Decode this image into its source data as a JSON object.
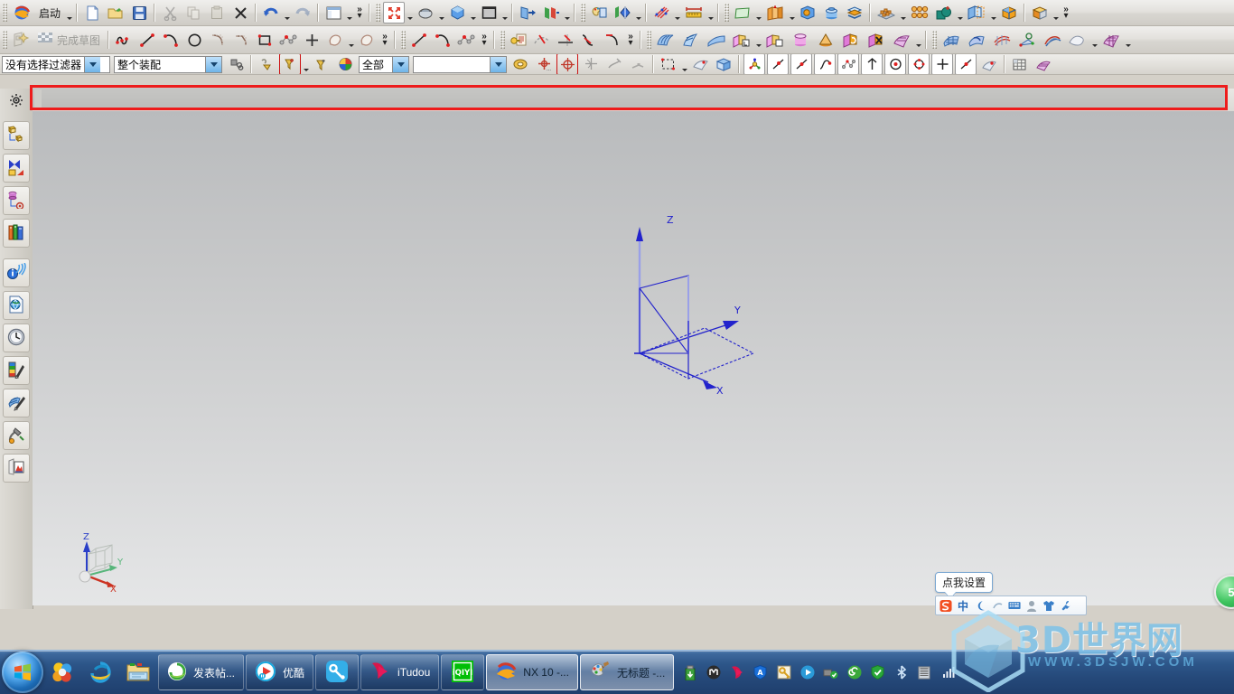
{
  "app": {
    "name": "NX 10",
    "colors": {
      "highlight_red": "#ee1c1c",
      "taskbar_blue": "#2d5689",
      "sketch_blue": "#2222dd",
      "watermark_blue": "#7ec2e8"
    }
  },
  "toolbar_row1": {
    "start_label": "启动",
    "items": [
      {
        "name": "nx-logo-icon",
        "icon": "nx-globe"
      },
      {
        "name": "start-menu-button",
        "icon": "text",
        "label": "启动",
        "caret": true
      },
      {
        "name": "new-file-button",
        "icon": "new-doc"
      },
      {
        "name": "open-file-button",
        "icon": "open-folder"
      },
      {
        "name": "save-button",
        "icon": "floppy"
      },
      {
        "name": "cut-button",
        "icon": "scissors",
        "disabled": true
      },
      {
        "name": "copy-button",
        "icon": "copy",
        "disabled": true
      },
      {
        "name": "paste-button",
        "icon": "paste",
        "disabled": true
      },
      {
        "name": "delete-button",
        "icon": "x-mark"
      },
      {
        "name": "undo-button",
        "icon": "undo",
        "caret": true
      },
      {
        "name": "redo-button",
        "icon": "redo",
        "disabled": true
      },
      {
        "name": "window-layout-button",
        "icon": "window",
        "caret": true
      },
      {
        "name": "fit-view-button",
        "icon": "fit-arrows",
        "caret": true
      },
      {
        "name": "zoom-button",
        "icon": "zoom-mouse",
        "caret": true
      },
      {
        "name": "rotate-button",
        "icon": "blue-cube",
        "caret": true
      },
      {
        "name": "shading-style-button",
        "icon": "gray-square",
        "caret": true
      },
      {
        "name": "show-hide-button",
        "icon": "blue-plane-arrow"
      },
      {
        "name": "hide-button",
        "icon": "green-red-plane",
        "caret": true
      },
      {
        "name": "edit-object-display-button",
        "icon": "palette-window"
      },
      {
        "name": "view-section-button",
        "icon": "section-flag",
        "caret": true
      },
      {
        "name": "measure-distance-button",
        "icon": "measure-pins",
        "caret": true
      },
      {
        "name": "measure-ruler-button",
        "icon": "ruler"
      },
      {
        "name": "datum-plane-button",
        "icon": "green-plane",
        "caret": true
      },
      {
        "name": "extrude-button",
        "icon": "orange-extrude",
        "caret": true
      },
      {
        "name": "hole-button",
        "icon": "blue-hole-cube"
      },
      {
        "name": "boss-button",
        "icon": "blue-cylinder"
      },
      {
        "name": "shell-button",
        "icon": "orange-shell"
      },
      {
        "name": "pattern-feature-button",
        "icon": "pattern-tray",
        "caret": true
      },
      {
        "name": "pattern-geometry-button",
        "icon": "pattern-grid"
      },
      {
        "name": "unite-button",
        "icon": "unite-green",
        "caret": true
      },
      {
        "name": "trim-body-button",
        "icon": "trim-cube",
        "caret": true
      },
      {
        "name": "edge-blend-button",
        "icon": "blend-cube"
      },
      {
        "name": "chamfer-button",
        "icon": "chamfer-cube",
        "caret": true
      }
    ]
  },
  "toolbar_row2": {
    "finish_sketch_label": "完成草图",
    "items": [
      {
        "name": "sketch-in-task-environment-button",
        "icon": "sketch-star",
        "disabled": true
      },
      {
        "name": "finish-sketch-button",
        "icon": "checkered-flag",
        "label": "完成草图",
        "disabled": true
      },
      {
        "name": "profile-button",
        "icon": "profile-curve"
      },
      {
        "name": "line-button",
        "icon": "line"
      },
      {
        "name": "arc-button",
        "icon": "arc"
      },
      {
        "name": "circle-button",
        "icon": "circle"
      },
      {
        "name": "fillet-button",
        "icon": "fillet"
      },
      {
        "name": "chamfer-sketch-button",
        "icon": "chamfer"
      },
      {
        "name": "rectangle-button",
        "icon": "rectangle"
      },
      {
        "name": "polygon-button",
        "icon": "studio-spline"
      },
      {
        "name": "point-button",
        "icon": "plus-point"
      },
      {
        "name": "offset-curve-button",
        "icon": "offset-blob",
        "caret": true
      },
      {
        "name": "pattern-curve-button",
        "icon": "pattern-blob"
      },
      {
        "name": "studio-spline-button",
        "icon": "spline-2pt"
      },
      {
        "name": "arc-3pt-button",
        "icon": "arc-3pt"
      },
      {
        "name": "fit-curve-button",
        "icon": "fit-curve"
      },
      {
        "name": "sketch-constraints-button",
        "icon": "key-doc"
      },
      {
        "name": "quick-trim-button",
        "icon": "quick-trim"
      },
      {
        "name": "quick-extend-button",
        "icon": "quick-extend"
      },
      {
        "name": "make-corner-button",
        "icon": "make-corner"
      },
      {
        "name": "corner-button",
        "icon": "corner"
      },
      {
        "name": "through-curve-mesh-button",
        "icon": "surface-mesh"
      },
      {
        "name": "ruled-button",
        "icon": "ruled-surface"
      },
      {
        "name": "swept-button",
        "icon": "swept-surface"
      },
      {
        "name": "extrude-sheet-button",
        "icon": "extrude-sheet",
        "caret": true
      },
      {
        "name": "revolve-sheet-button",
        "icon": "revolve-sheet",
        "caret": true
      },
      {
        "name": "tube-button",
        "icon": "tube"
      },
      {
        "name": "cone-button",
        "icon": "cone"
      },
      {
        "name": "replace-face-button",
        "icon": "replace-face"
      },
      {
        "name": "delete-face-button",
        "icon": "delete-face"
      },
      {
        "name": "trim-sheet-button",
        "icon": "trim-sheet",
        "caret": true
      },
      {
        "name": "four-point-surface-button",
        "icon": "four-point-surface"
      },
      {
        "name": "studio-surface-button",
        "icon": "studio-surface"
      },
      {
        "name": "n-sided-surface-button",
        "icon": "n-sided-surface"
      },
      {
        "name": "offset-surface-button",
        "icon": "offset-surface"
      },
      {
        "name": "bridge-surface-button",
        "icon": "bridge-surface"
      },
      {
        "name": "untrim-button",
        "icon": "untrim",
        "caret": true
      },
      {
        "name": "sheet-extend-button",
        "icon": "sheet-extend",
        "caret": true
      }
    ]
  },
  "toolbar_row3": {
    "selection_filter": {
      "name": "selection-filter-combo",
      "value": "没有选择过滤器"
    },
    "scope_filter": {
      "name": "assembly-scope-combo",
      "value": "整个装配"
    },
    "type_filter": {
      "name": "type-filter-combo",
      "value": "全部"
    },
    "layer_filter": {
      "name": "layer-filter-combo",
      "value": ""
    },
    "items": [
      {
        "name": "keep-selected-button",
        "icon": "keep-selected"
      },
      {
        "name": "general-selection-filter-button",
        "icon": "filter-plus",
        "highlight": true,
        "caret": true
      },
      {
        "name": "feature-filter-button",
        "icon": "filter-yellow"
      },
      {
        "name": "color-filter-button",
        "icon": "color-wheel"
      },
      {
        "name": "snap-point-settings-button",
        "icon": "snap-settings"
      },
      {
        "name": "enable-snap-button",
        "icon": "snap-target"
      },
      {
        "name": "snap-arc-center-button",
        "icon": "snap-center",
        "highlight": true
      },
      {
        "name": "snap-quadrant-button",
        "icon": "snap-quadrant"
      },
      {
        "name": "snap-existing-point-button",
        "icon": "snap-existing"
      },
      {
        "name": "snap-endpoint-button",
        "icon": "snap-endpoint",
        "disabled": true
      },
      {
        "name": "snap-control-point-button",
        "icon": "snap-control",
        "disabled": true
      },
      {
        "name": "rectangle-select-button",
        "icon": "rect-select",
        "caret": true
      },
      {
        "name": "select-faces-button",
        "icon": "face-select"
      },
      {
        "name": "select-body-button",
        "icon": "body-select"
      },
      {
        "name": "datum-csys-button",
        "icon": "datum-csys",
        "framed": true
      },
      {
        "name": "point-constructor-button",
        "icon": "point-line",
        "framed": true
      },
      {
        "name": "line-snap-button",
        "icon": "line-plain",
        "framed": true
      },
      {
        "name": "curve-snap-button",
        "icon": "curve-snap",
        "framed": true
      },
      {
        "name": "spline-snap-button",
        "icon": "spline-snap",
        "framed": true
      },
      {
        "name": "axis-snap-button",
        "icon": "axis-snap",
        "framed": true
      },
      {
        "name": "circle-center-snap-button",
        "icon": "circle-center",
        "framed": true
      },
      {
        "name": "quadrant-snap-button",
        "icon": "quadrant-snap",
        "framed": true
      },
      {
        "name": "point-snap-button",
        "icon": "plus-snap",
        "framed": true
      },
      {
        "name": "midpoint-snap-button",
        "icon": "mid-snap",
        "framed": true
      },
      {
        "name": "surface-snap-button",
        "icon": "surface-snap"
      },
      {
        "name": "grid-button",
        "icon": "grid-table"
      },
      {
        "name": "sketch-plane-button",
        "icon": "sketch-plane"
      }
    ]
  },
  "left_resource_bar": {
    "items": [
      {
        "name": "sidebar-item-settings",
        "icon": "gear-icon"
      },
      {
        "name": "sidebar-item-assembly-navigator",
        "icon": "assembly-tree-icon"
      },
      {
        "name": "sidebar-item-constraint-navigator",
        "icon": "constraint-icon"
      },
      {
        "name": "sidebar-item-part-navigator",
        "icon": "part-tree-icon"
      },
      {
        "name": "sidebar-item-reuse-library",
        "icon": "books-icon"
      },
      {
        "name": "sidebar-item-hd3d-tools",
        "icon": "info-signal-icon"
      },
      {
        "name": "sidebar-item-web-browser",
        "icon": "web-page-icon"
      },
      {
        "name": "sidebar-item-history",
        "icon": "clock-icon"
      },
      {
        "name": "sidebar-item-system-materials",
        "icon": "materials-icon"
      },
      {
        "name": "sidebar-item-system-scenes",
        "icon": "scenes-icon"
      },
      {
        "name": "sidebar-item-system-visual-effects",
        "icon": "effects-icon"
      },
      {
        "name": "sidebar-item-roles",
        "icon": "roles-icon"
      }
    ]
  },
  "viewport": {
    "csys_labels": {
      "x": "X",
      "y": "Y",
      "z": "Z"
    },
    "triad_labels": {
      "x": "X",
      "y": "Y",
      "z": "Z"
    }
  },
  "ime": {
    "tooltip": "点我设置",
    "items": [
      {
        "name": "sogou-logo-icon",
        "glyph": "S"
      },
      {
        "name": "chinese-mode-icon",
        "glyph": "中"
      },
      {
        "name": "moon-icon",
        "glyph": "☽"
      },
      {
        "name": "punctuation-icon",
        "glyph": "⌐"
      },
      {
        "name": "soft-keyboard-icon",
        "glyph": "⌨"
      },
      {
        "name": "user-icon",
        "glyph": "👤"
      },
      {
        "name": "skin-icon",
        "glyph": "👕"
      },
      {
        "name": "toolbox-icon",
        "glyph": "🔧"
      }
    ]
  },
  "taskbar": {
    "start_button": {
      "name": "start-button"
    },
    "quick_launch": [
      {
        "name": "quicklaunch-360-browser",
        "icon": "flower-360"
      },
      {
        "name": "quicklaunch-internet-explorer",
        "icon": "ie"
      },
      {
        "name": "quicklaunch-file-explorer",
        "icon": "folder"
      }
    ],
    "windows": [
      {
        "name": "taskbar-window-post",
        "label": "发表帖...",
        "icon": "green-ie",
        "active": false
      },
      {
        "name": "taskbar-window-youku",
        "label": "优酷",
        "icon": "youku",
        "active": false
      },
      {
        "name": "taskbar-window-baofeng",
        "label": "",
        "icon": "baofeng",
        "active": false
      },
      {
        "name": "taskbar-window-itudou",
        "label": "iTudou",
        "icon": "itudou",
        "active": false
      },
      {
        "name": "taskbar-window-iqiyi",
        "label": "",
        "icon": "iqiyi",
        "active": false
      },
      {
        "name": "taskbar-window-nx",
        "label": "NX 10 -...",
        "icon": "nx",
        "active": true
      },
      {
        "name": "taskbar-window-paint",
        "label": "无标题 -...",
        "icon": "paint",
        "active": true
      }
    ],
    "tray": [
      {
        "name": "tray-usb-icon",
        "icon": "usb-green"
      },
      {
        "name": "tray-mcafee-icon",
        "icon": "m-circle"
      },
      {
        "name": "tray-itudou-icon",
        "icon": "i-pink"
      },
      {
        "name": "tray-alipay-icon",
        "icon": "a-shield"
      },
      {
        "name": "tray-key-icon",
        "icon": "key-yellow"
      },
      {
        "name": "tray-player-icon",
        "icon": "play-blue"
      },
      {
        "name": "tray-safe-eject-icon",
        "icon": "eject-check"
      },
      {
        "name": "tray-360-safe-icon",
        "icon": "shield-360"
      },
      {
        "name": "tray-360-guard-icon",
        "icon": "guard-green"
      },
      {
        "name": "tray-bluetooth-icon",
        "icon": "bluetooth"
      },
      {
        "name": "tray-network-icon",
        "icon": "network-bars"
      },
      {
        "name": "tray-volume-icon",
        "icon": "volume"
      }
    ]
  },
  "watermark": {
    "title": "3D世界网",
    "url": "WWW.3DSJW.COM"
  },
  "badge": {
    "label": "5"
  }
}
